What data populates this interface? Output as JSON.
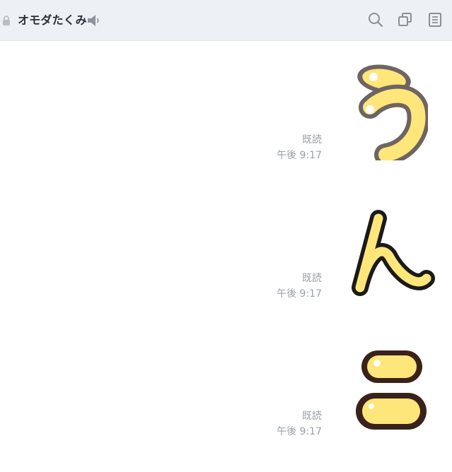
{
  "header": {
    "title": "オモダたくみ",
    "icons": [
      "lock-icon",
      "speaker-icon",
      "search-icon",
      "copy-icon",
      "notes-icon"
    ]
  },
  "messages": [
    {
      "read_label": "既読",
      "time": "午後 9:17",
      "sticker": "hiragana-u-sticker"
    },
    {
      "read_label": "既読",
      "time": "午後 9:17",
      "sticker": "hiragana-n-sticker"
    },
    {
      "read_label": "既読",
      "time": "午後 9:17",
      "sticker": "hiragana-ni-sticker"
    }
  ],
  "colors": {
    "header_bg": "#edf0f4",
    "sticker_fill": "#ffe67a",
    "meta_text": "#9aa0a8"
  }
}
